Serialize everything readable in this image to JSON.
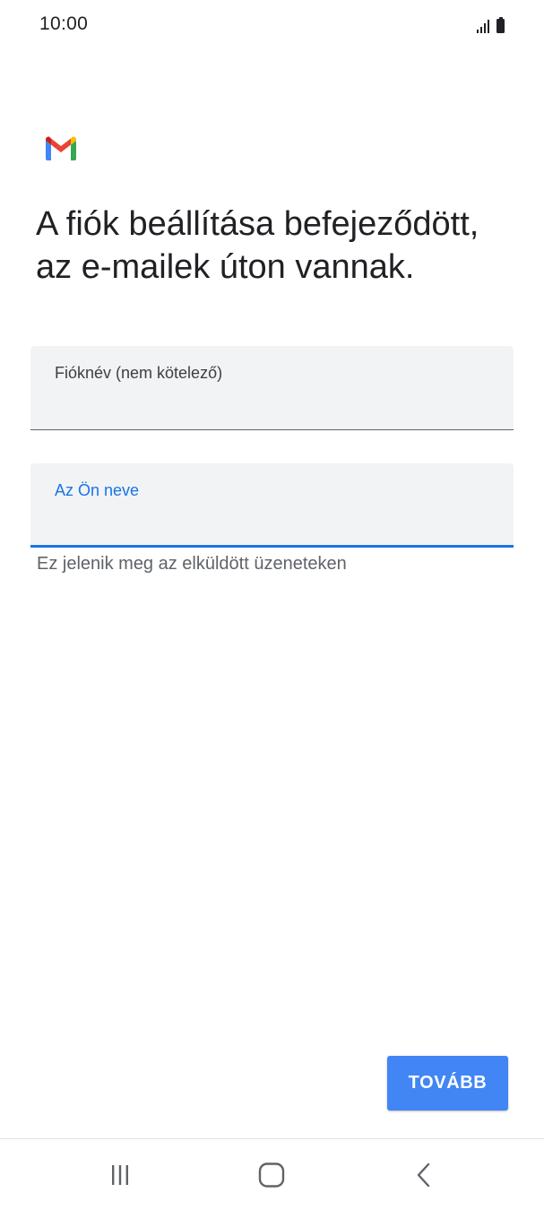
{
  "status_bar": {
    "time": "10:00",
    "icons": [
      "signal-icon",
      "battery-icon"
    ]
  },
  "app": {
    "logo": "gmail-logo-icon",
    "brand_colors": {
      "red": "#EA4335",
      "blue": "#4285F4",
      "green": "#34A853",
      "yellow": "#FBBC04",
      "dark_red": "#C5221F"
    }
  },
  "main": {
    "headline": "A fiók beállítása befejeződött, az e-mailek úton vannak.",
    "account_name_field": {
      "label": "Fióknév (nem kötelező)",
      "value": ""
    },
    "your_name_field": {
      "label": "Az Ön neve",
      "value": "",
      "focused": true
    },
    "helper_text": "Ez jelenik meg az elküldött üzeneteken",
    "next_button": "TOVÁBB"
  },
  "nav_bar": {
    "items": [
      "recents-icon",
      "home-icon",
      "back-icon"
    ]
  },
  "colors": {
    "accent": "#1a73e8",
    "button": "#4285f4",
    "field_bg": "#f1f3f4"
  }
}
